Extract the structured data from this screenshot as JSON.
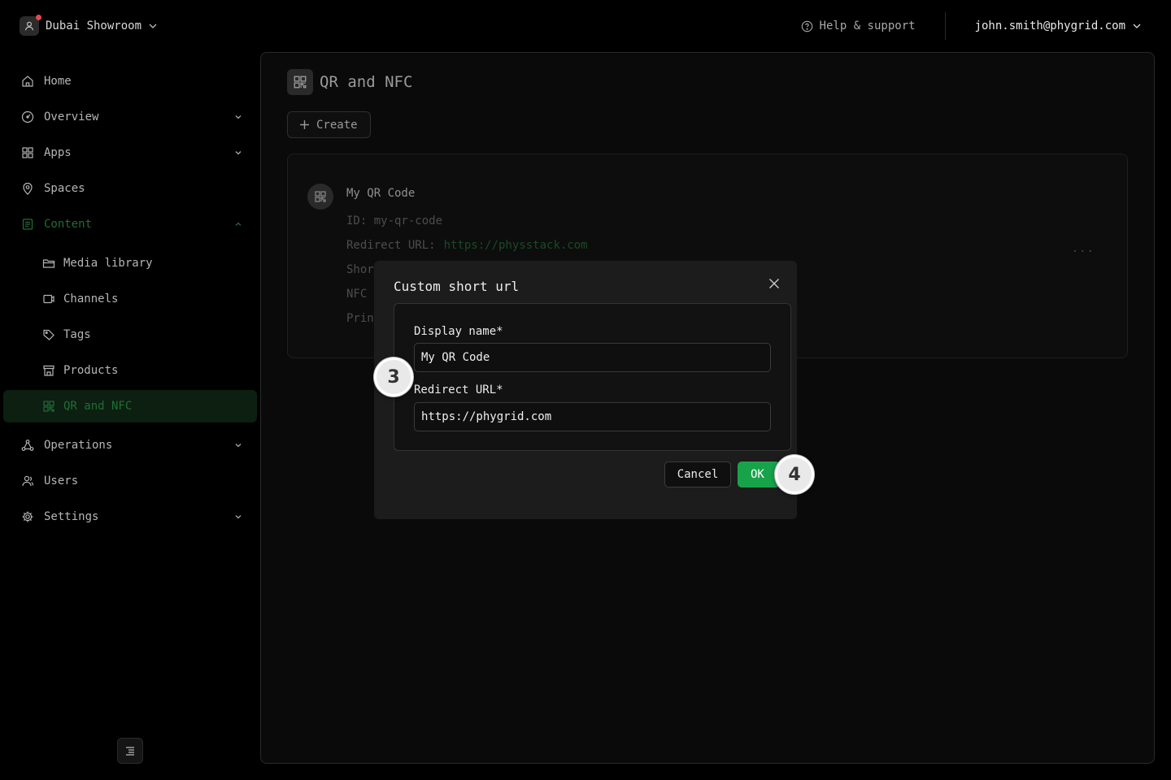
{
  "header": {
    "workspace": "Dubai Showroom",
    "help": "Help & support",
    "user": "john.smith@phygrid.com"
  },
  "sidebar": {
    "items": [
      {
        "label": "Home",
        "icon": "home-icon"
      },
      {
        "label": "Overview",
        "icon": "dashboard-icon"
      },
      {
        "label": "Apps",
        "icon": "grid-icon"
      },
      {
        "label": "Spaces",
        "icon": "map-pin-icon"
      },
      {
        "label": "Content",
        "icon": "content-icon"
      },
      {
        "label": "Media library",
        "icon": "folder-icon"
      },
      {
        "label": "Channels",
        "icon": "channel-icon"
      },
      {
        "label": "Tags",
        "icon": "tag-icon"
      },
      {
        "label": "Products",
        "icon": "store-icon"
      },
      {
        "label": "QR and NFC",
        "icon": "qr-icon"
      },
      {
        "label": "Operations",
        "icon": "operations-icon"
      },
      {
        "label": "Users",
        "icon": "users-icon"
      },
      {
        "label": "Settings",
        "icon": "gear-icon"
      }
    ],
    "active": "QR and NFC",
    "accent": "#1f6e36"
  },
  "page": {
    "title": "QR and NFC",
    "create_label": "Create"
  },
  "card": {
    "name": "My QR Code",
    "id_row": "ID: my-qr-code",
    "redirect_label": "Redirect URL:",
    "redirect_url": "https://physstack.com",
    "short_row": "Shor",
    "nfc_row": "NFC",
    "print_row": "Prin",
    "more": "···"
  },
  "dialog": {
    "title": "Custom short url",
    "display_name_label": "Display name*",
    "display_name_value": "My QR Code",
    "redirect_label": "Redirect URL*",
    "redirect_value": "https://phygrid.com",
    "cancel_label": "Cancel",
    "ok_label": "OK",
    "ok_color": "#17a34a"
  },
  "steps": {
    "step_a": "3",
    "step_b": "4"
  }
}
